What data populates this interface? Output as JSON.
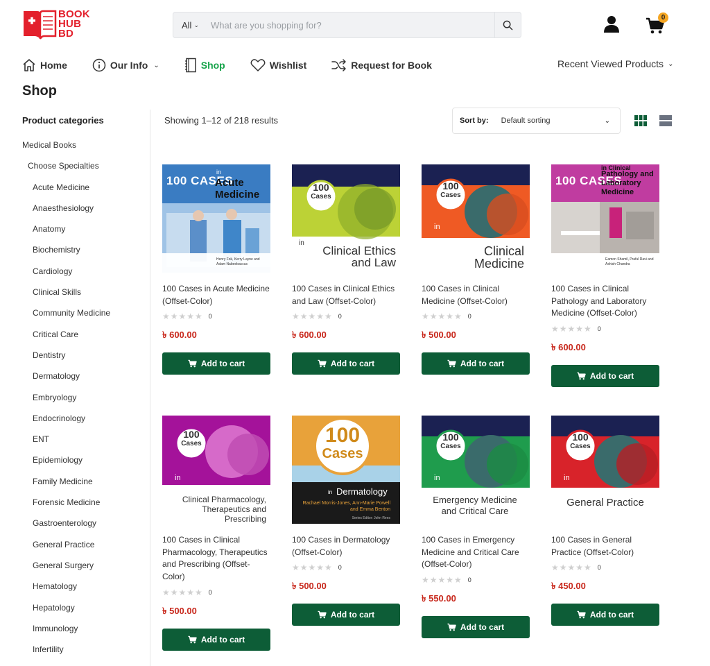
{
  "brand": {
    "logo_lines": [
      "BOOK",
      "HUB",
      "BD"
    ],
    "colors": {
      "brand_red": "#e3202c",
      "accent_green": "#16a34a",
      "button_green": "#0d5d37",
      "price_red": "#c8281c",
      "badge": "#f5a623"
    }
  },
  "search": {
    "category": "All",
    "placeholder": "What are you shopping for?",
    "icon": "search-icon"
  },
  "header": {
    "user_icon": "user-icon",
    "cart_icon": "cart-icon",
    "cart_count": "0"
  },
  "nav": {
    "items": [
      {
        "label": "Home",
        "icon": "home-icon"
      },
      {
        "label": "Our Info",
        "icon": "info-icon"
      },
      {
        "label": "Shop",
        "icon": "book-icon",
        "active": true
      },
      {
        "label": "Wishlist",
        "icon": "heart-icon"
      },
      {
        "label": "Request for Book",
        "icon": "shuffle-icon"
      }
    ],
    "recent": "Recent Viewed Products"
  },
  "page": {
    "title": "Shop"
  },
  "sidebar": {
    "heading": "Product categories",
    "top": "Medical Books",
    "sub": "Choose Specialties",
    "items": [
      "Acute Medicine",
      "Anaesthesiology",
      "Anatomy",
      "Biochemistry",
      "Cardiology",
      "Clinical Skills",
      "Community Medicine",
      "Critical Care",
      "Dentistry",
      "Dermatology",
      "Embryology",
      "Endocrinology",
      "ENT",
      "Epidemiology",
      "Family Medicine",
      "Forensic Medicine",
      "Gastroenterology",
      "General Practice",
      "General Surgery",
      "Hematology",
      "Hepatology",
      "Immunology",
      "Infertility"
    ]
  },
  "toolbar": {
    "result_count": "Showing 1–12 of 218 results",
    "sort_label": "Sort by:",
    "sort_value": "Default sorting"
  },
  "products": [
    {
      "title": "100 Cases in Acute Medicine (Offset-Color)",
      "price": "৳ 600.00",
      "rating_count": "0",
      "button": "Add to cart",
      "cover": {
        "big": "100 CASES",
        "small": "in",
        "subject": "Acute Medicine",
        "authors": "Henry Fok, Kerry Layne and Adam Nabeebaccus"
      }
    },
    {
      "title": "100 Cases in Clinical Ethics and Law (Offset-Color)",
      "price": "৳ 600.00",
      "rating_count": "0",
      "button": "Add to cart",
      "cover": {
        "badge_top": "100",
        "badge_bottom": "Cases",
        "small": "in",
        "subject": "Clinical Ethics and Law"
      }
    },
    {
      "title": "100 Cases in Clinical Medicine (Offset-Color)",
      "price": "৳ 500.00",
      "rating_count": "0",
      "button": "Add to cart",
      "cover": {
        "badge_top": "100",
        "badge_bottom": "Cases",
        "small": "in",
        "subject": "Clinical Medicine"
      }
    },
    {
      "title": "100 Cases in Clinical Pathology and Laboratory Medicine (Offset-Color)",
      "price": "৳ 600.00",
      "rating_count": "0",
      "button": "Add to cart",
      "cover": {
        "big": "100 CASES",
        "small": "in Clinical",
        "subject": "Pathology and Laboratory Medicine",
        "authors": "Eamon Shamil, Praful Ravi and Ashish Chandra"
      }
    },
    {
      "title": "100 Cases in Clinical Pharmacology, Therapeutics and Prescribing (Offset-Color)",
      "price": "৳ 500.00",
      "rating_count": "0",
      "button": "Add to cart",
      "cover": {
        "badge_top": "100",
        "badge_bottom": "Cases",
        "small": "in",
        "subject": "Clinical Pharmacology, Therapeutics and Prescribing"
      }
    },
    {
      "title": "100 Cases in Dermatology (Offset-Color)",
      "price": "৳ 500.00",
      "rating_count": "0",
      "button": "Add to cart",
      "cover": {
        "badge_top": "100",
        "badge_bottom": "Cases",
        "small": "in",
        "subject": "Dermatology",
        "authors": "Rachael Morris-Jones, Ann-Marie Powell and Emma Benton",
        "editor": "Series Editor: John Rees"
      }
    },
    {
      "title": "100 Cases in Emergency Medicine and Critical Care (Offset-Color)",
      "price": "৳ 550.00",
      "rating_count": "0",
      "button": "Add to cart",
      "cover": {
        "badge_top": "100",
        "badge_bottom": "Cases",
        "small": "in",
        "subject": "Emergency Medicine and Critical Care"
      }
    },
    {
      "title": "100 Cases in General Practice (Offset-Color)",
      "price": "৳ 450.00",
      "rating_count": "0",
      "button": "Add to cart",
      "cover": {
        "badge_top": "100",
        "badge_bottom": "Cases",
        "small": "in",
        "subject": "General Practice"
      }
    }
  ]
}
